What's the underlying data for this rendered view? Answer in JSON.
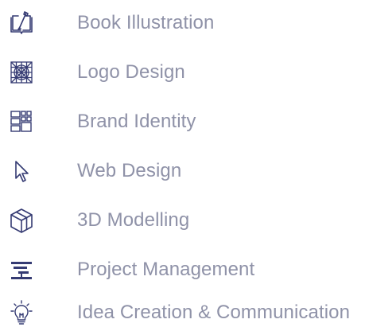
{
  "colors": {
    "icon": "#353b73",
    "text": "#8f92a8"
  },
  "services": [
    {
      "icon": "book-brush-icon",
      "label": "Book Illustration"
    },
    {
      "icon": "logo-grid-icon",
      "label": "Logo Design"
    },
    {
      "icon": "layout-blocks-icon",
      "label": "Brand Identity"
    },
    {
      "icon": "cursor-icon",
      "label": "Web Design"
    },
    {
      "icon": "cube-icon",
      "label": "3D Modelling"
    },
    {
      "icon": "timeline-bars-icon",
      "label": "Project Management"
    },
    {
      "icon": "lightbulb-icon",
      "label": "Idea Creation & Communication"
    }
  ]
}
